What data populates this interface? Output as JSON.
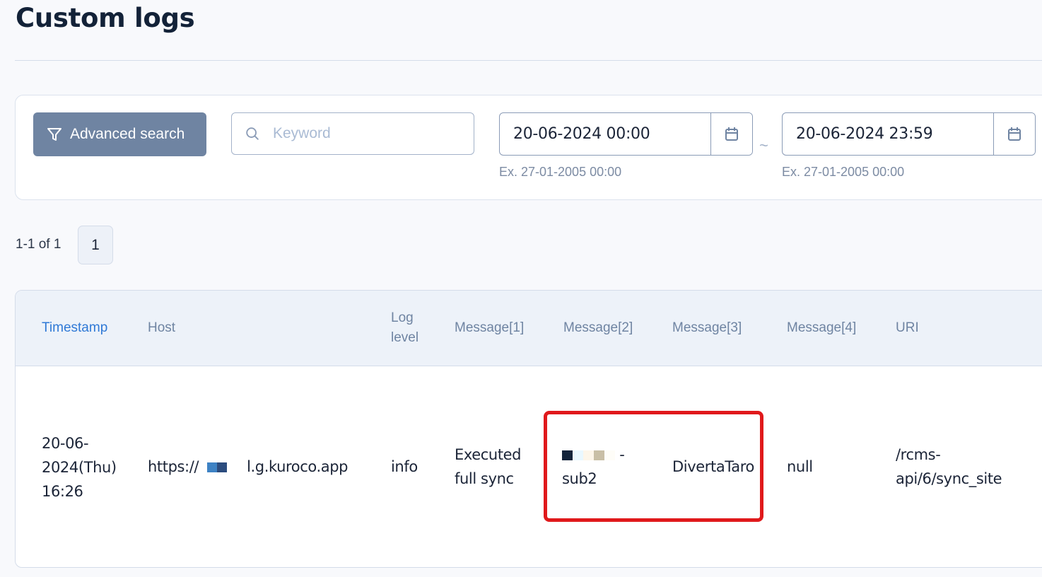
{
  "page": {
    "title": "Custom logs"
  },
  "search": {
    "advanced_label": "Advanced search",
    "keyword_placeholder": "Keyword",
    "keyword_value": "",
    "date_from": "20-06-2024 00:00",
    "date_to": "20-06-2024 23:59",
    "date_from_hint": "Ex. 27-01-2005 00:00",
    "date_to_hint": "Ex. 27-01-2005 00:00",
    "range_separator": "~"
  },
  "pagination": {
    "info": "1-1 of 1",
    "pages": [
      "1"
    ],
    "current": "1"
  },
  "table": {
    "columns": [
      "Timestamp",
      "Host",
      "Log level",
      "Message[1]",
      "Message[2]",
      "Message[3]",
      "Message[4]",
      "URI"
    ],
    "sorted_column": "Timestamp",
    "rows": [
      {
        "timestamp": [
          "20-06-",
          "2024(Thu)",
          "16:26"
        ],
        "host_prefix": "https://",
        "host_suffix": "l.g.kuroco.app",
        "log_level": "info",
        "message1": [
          "Executed",
          "full sync"
        ],
        "message2_suffix": "-",
        "message2_line2": "sub2",
        "message3": "DivertaTaro",
        "message4": "null",
        "uri": [
          "/rcms-",
          "api/6/sync_site"
        ]
      }
    ]
  },
  "annotations": {
    "highlight_color": "#e0191b"
  },
  "colors": {
    "accent": "#2f79d6",
    "button": "#6f84a2",
    "header_bg": "#edf2f9"
  }
}
